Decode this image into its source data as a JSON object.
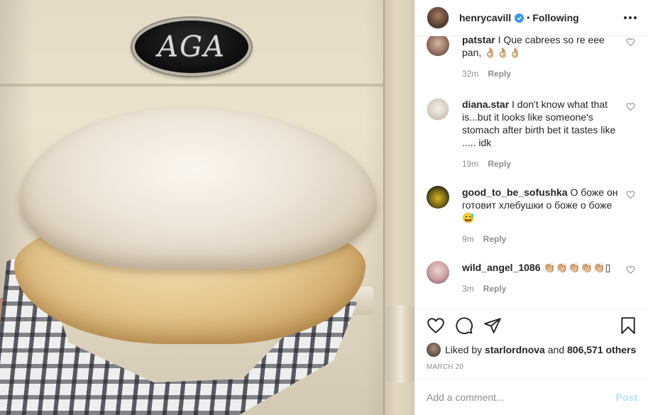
{
  "photo": {
    "badge_text": "AGA"
  },
  "header": {
    "username": "henrycavill",
    "separator": "•",
    "follow_state": "Following"
  },
  "comments": [
    {
      "username": "patstar",
      "text": "I Que cabrees so re eee pan, 👌🏼👌🏼👌🏼",
      "time": "32m",
      "reply_label": "Reply"
    },
    {
      "username": "diana.star",
      "text": "I don't know what that is...but it looks like someone's stomach after birth bet it tastes like ..... idk",
      "time": "19m",
      "reply_label": "Reply"
    },
    {
      "username": "good_to_be_sofushka",
      "text": "О боже он готовит хлебушки о боже о боже😅",
      "time": "9m",
      "reply_label": "Reply"
    },
    {
      "username": "wild_angel_1086",
      "text": "👏🏼👏🏼👏🏼👏🏼👏🏼▯",
      "time": "3m",
      "reply_label": "Reply"
    }
  ],
  "likes": {
    "prefix": "Liked by",
    "user": "starlordnova",
    "joiner": "and",
    "others": "806,571 others"
  },
  "date": "MARCH 20",
  "add_comment": {
    "placeholder": "Add a comment...",
    "post_label": "Post"
  },
  "colors": {
    "accent": "#3897f0",
    "post_disabled": "#b2dffc",
    "meta_text": "#8e8e8e"
  },
  "icons": [
    "verified-icon",
    "more-options-icon",
    "heart-icon",
    "comment-icon",
    "share-icon",
    "bookmark-icon"
  ]
}
